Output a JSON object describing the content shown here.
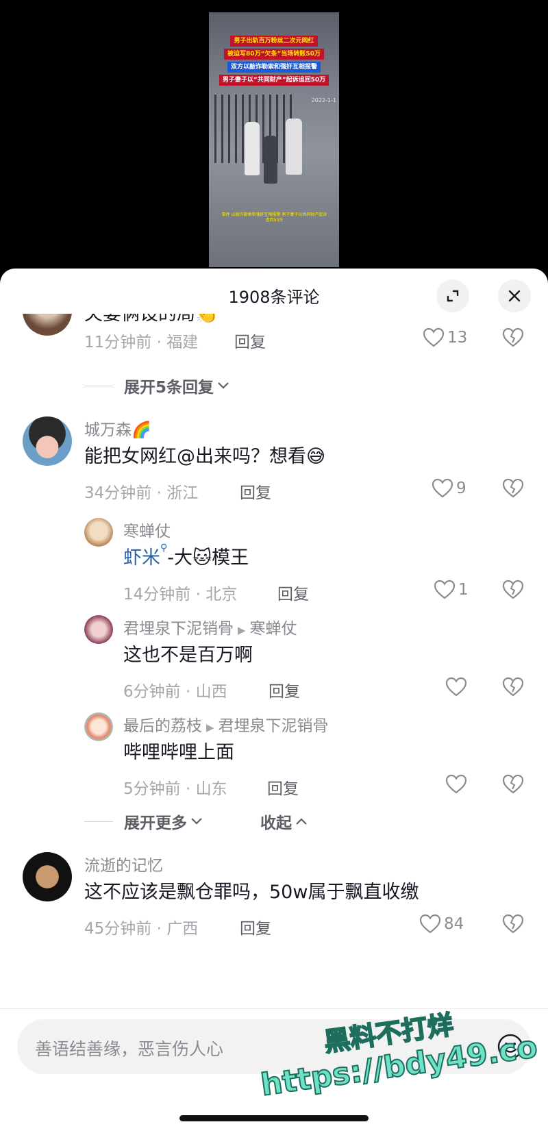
{
  "video": {
    "captions": [
      "男子出轨百万粉丝二次元网红",
      "被迫写80万“欠条”当场转账50万",
      "双方以敲诈勒索和强奸互相报警",
      "男子妻子以“共同财产”起诉追回50万"
    ],
    "timestamp": "2022-1-1",
    "subtitle": "事件 以敲诈勒索和强奸互相报警 男子妻子以共同财产起诉追回50万"
  },
  "sheet": {
    "title": "1908条评论"
  },
  "comments": [
    {
      "text": "夫妻俩设的局👏",
      "time": "11分钟前 · 福建",
      "reply": "回复",
      "likes": "13"
    },
    {
      "username": "城万森🌈",
      "text": "能把女网红@出来吗？想看😅",
      "time": "34分钟前 · 浙江",
      "reply": "回复",
      "likes": "9"
    },
    {
      "username": "流逝的记忆",
      "text": "这不应该是飘仓罪吗，50w属于飘直收缴",
      "time": "45分钟前 · 广西",
      "reply": "回复",
      "likes": "84"
    }
  ],
  "expand_replies_1": "展开5条回复",
  "replies": [
    {
      "username": "寒蝉仗",
      "link": "虾米",
      "text": "-大🐱模王",
      "time": "14分钟前 · 北京",
      "reply": "回复",
      "likes": "1"
    },
    {
      "username": "君埋泉下泥销骨",
      "reply_to": "寒蝉仗",
      "text": "这也不是百万啊",
      "time": "6分钟前 · 山西",
      "reply": "回复",
      "likes": ""
    },
    {
      "username": "最后的荔枝",
      "reply_to": "君埋泉下泥销骨",
      "text": "哔哩哔哩上面",
      "time": "5分钟前 · 山东",
      "reply": "回复",
      "likes": ""
    }
  ],
  "expand_more": "展开更多",
  "collapse": "收起",
  "input": {
    "placeholder": "善语结善缘，恶言伤人心"
  },
  "watermark": {
    "line1": "黑料不打烊",
    "line2": "https://bdy49.co"
  }
}
